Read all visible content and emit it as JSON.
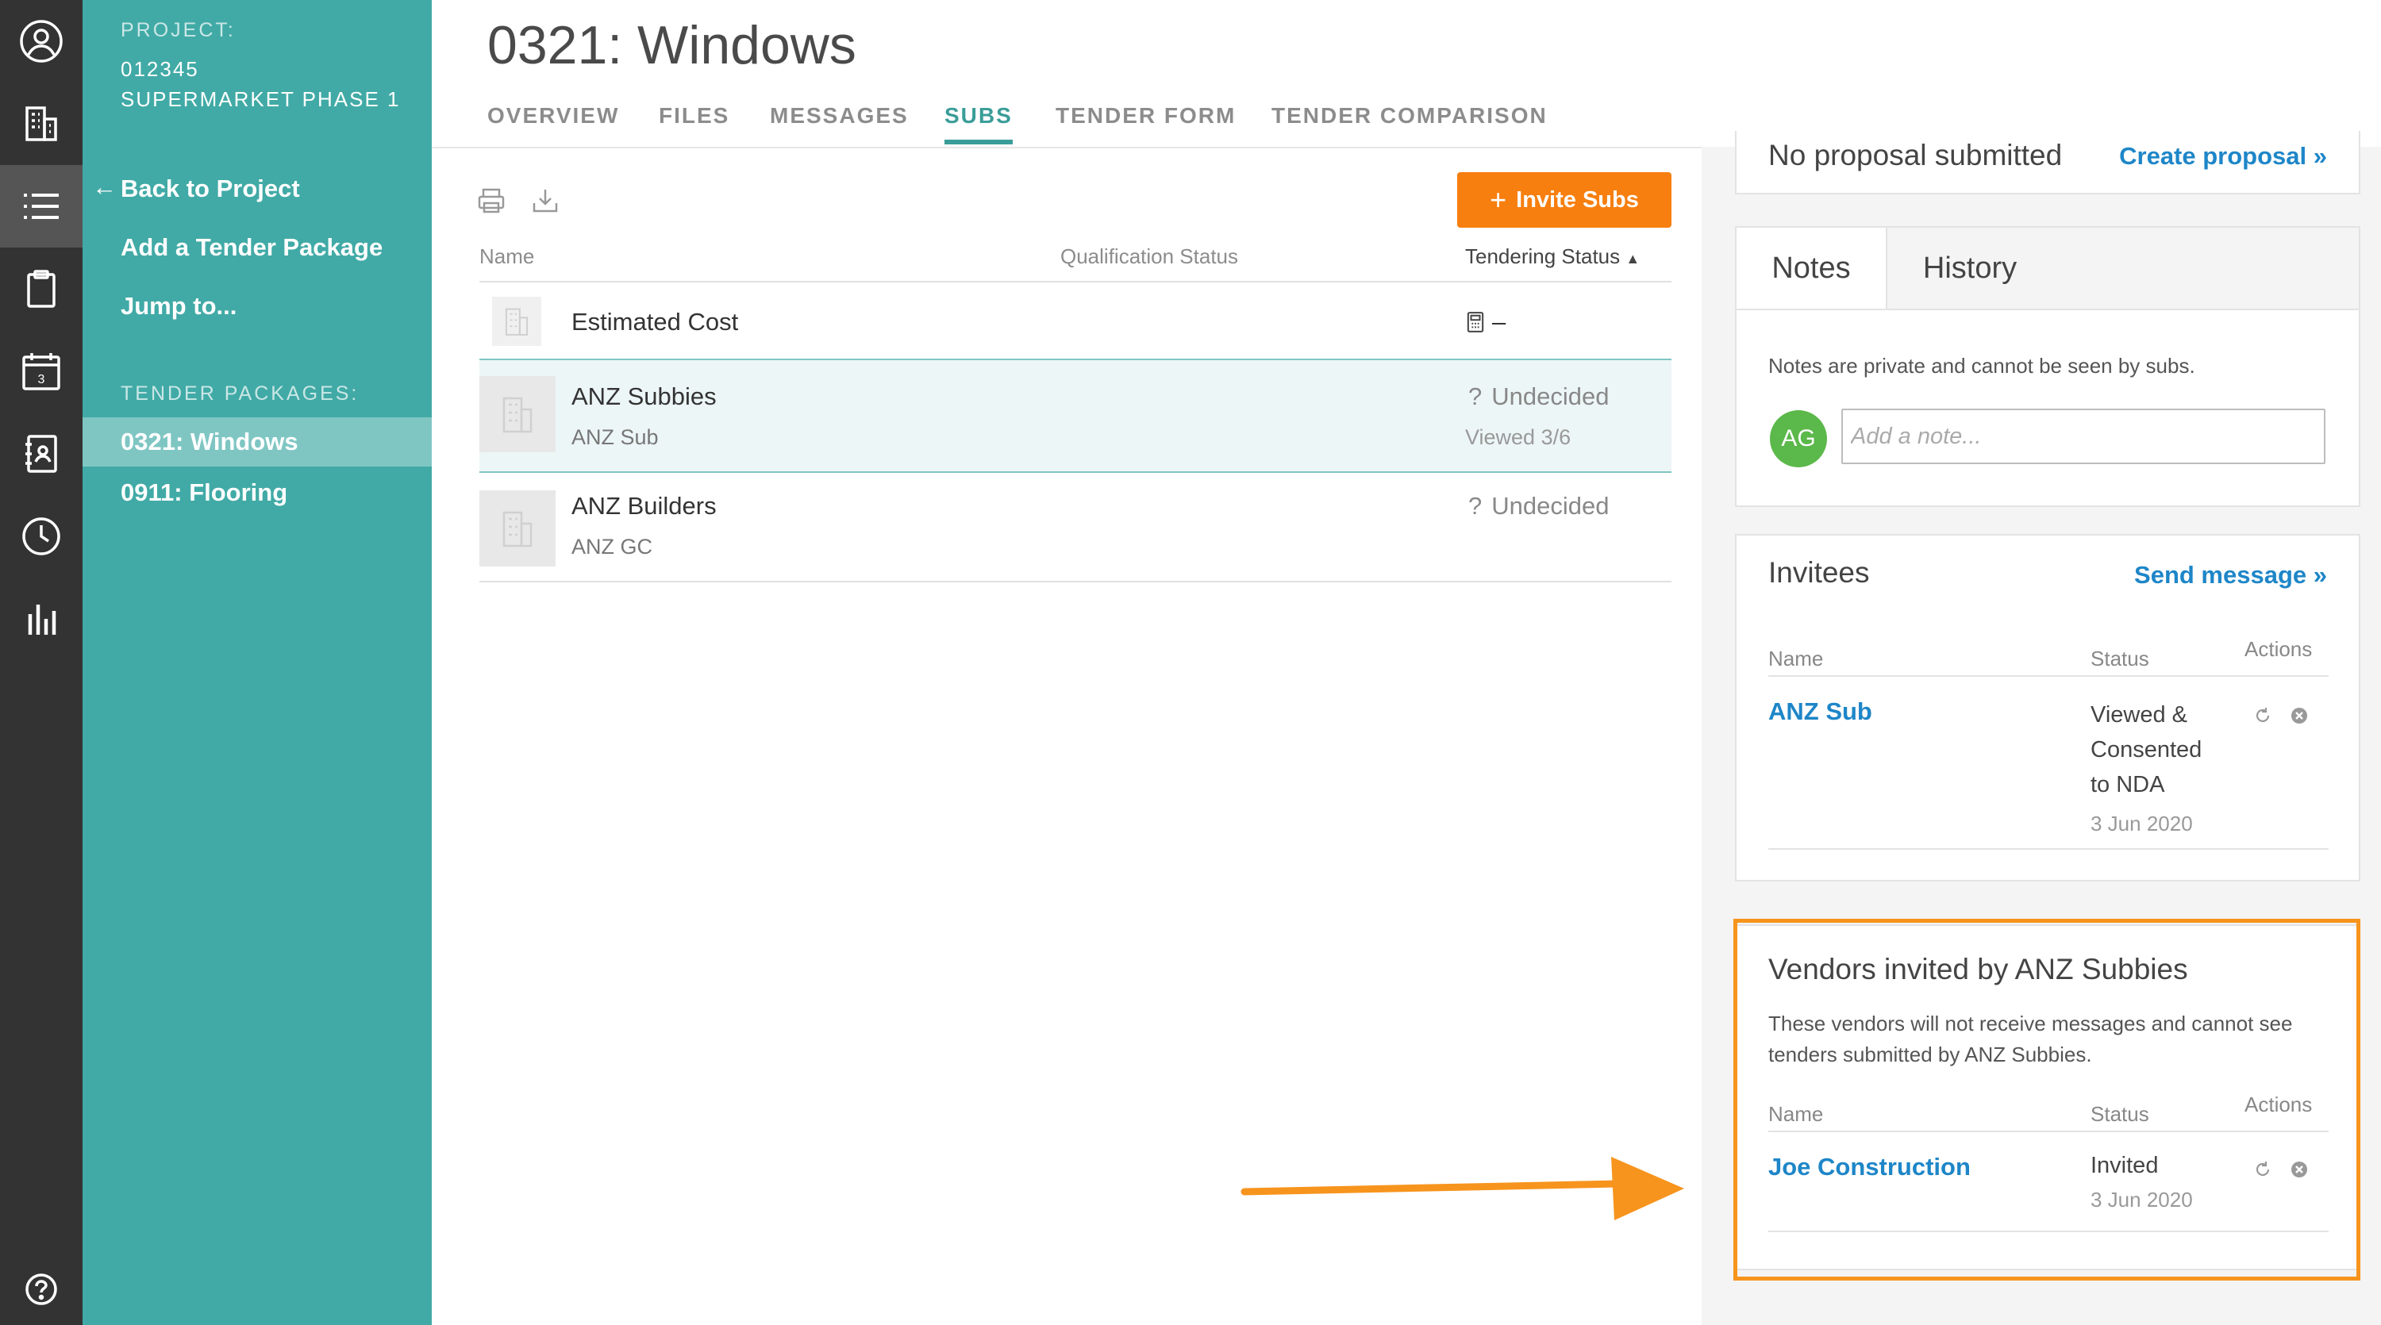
{
  "rail": {
    "icons": [
      "user-circle-icon",
      "buildings-icon",
      "list-icon",
      "clipboard-icon",
      "calendar-icon",
      "address-book-icon",
      "clock-icon",
      "bar-chart-icon",
      "help-icon"
    ],
    "calendar_day": "3"
  },
  "sidebar": {
    "project_caption": "PROJECT:",
    "project_number": "012345",
    "project_name": "SUPERMARKET PHASE 1",
    "back_link": "Back to Project",
    "add_package": "Add a Tender Package",
    "jump_to": "Jump to...",
    "packages_caption": "TENDER PACKAGES:",
    "packages": [
      {
        "label": "0321: Windows",
        "active": true
      },
      {
        "label": "0911: Flooring",
        "active": false
      }
    ]
  },
  "header": {
    "title": "0321: Windows",
    "tabs": [
      {
        "label": "OVERVIEW",
        "active": false
      },
      {
        "label": "FILES",
        "active": false
      },
      {
        "label": "MESSAGES",
        "active": false
      },
      {
        "label": "SUBS",
        "active": true
      },
      {
        "label": "TENDER FORM",
        "active": false
      },
      {
        "label": "TENDER COMPARISON",
        "active": false
      }
    ]
  },
  "subs_table": {
    "invite_button": "Invite Subs",
    "columns": {
      "name": "Name",
      "qualification": "Qualification Status",
      "tendering": "Tendering Status"
    },
    "estimated_cost": {
      "label": "Estimated Cost",
      "value": "–"
    },
    "rows": [
      {
        "name": "ANZ Subbies",
        "contact": "ANZ Sub",
        "status": "Undecided",
        "viewed": "Viewed 3/6",
        "selected": true
      },
      {
        "name": "ANZ Builders",
        "contact": "ANZ GC",
        "status": "Undecided",
        "viewed": "",
        "selected": false
      }
    ]
  },
  "proposal": {
    "text": "No proposal submitted",
    "link": "Create proposal »"
  },
  "notes_card": {
    "tab_notes": "Notes",
    "tab_history": "History",
    "privacy_text": "Notes are private and cannot be seen by subs.",
    "avatar_initials": "AG",
    "note_placeholder": "Add a note..."
  },
  "invitees_card": {
    "title": "Invitees",
    "send_message": "Send message »",
    "columns": {
      "name": "Name",
      "status": "Status",
      "actions": "Actions"
    },
    "rows": [
      {
        "name": "ANZ Sub",
        "status_lines": [
          "Viewed &",
          "Consented",
          "to NDA"
        ],
        "date": "3 Jun 2020"
      }
    ]
  },
  "vendors_card": {
    "title": "Vendors invited by ANZ Subbies",
    "description_line1": "These vendors will not receive messages and cannot see",
    "description_line2": "tenders submitted by ANZ Subbies.",
    "columns": {
      "name": "Name",
      "status": "Status",
      "actions": "Actions"
    },
    "rows": [
      {
        "name": "Joe Construction",
        "status": "Invited",
        "date": "3 Jun 2020"
      }
    ]
  },
  "colors": {
    "sidebar_teal": "#41aaa6",
    "accent_teal": "#3a9d99",
    "invite_orange": "#f77f0f",
    "highlight_orange": "#f7941d",
    "link_blue": "#1e86c8",
    "rail_dark": "#333333",
    "avatar_green": "#5bb84a"
  }
}
